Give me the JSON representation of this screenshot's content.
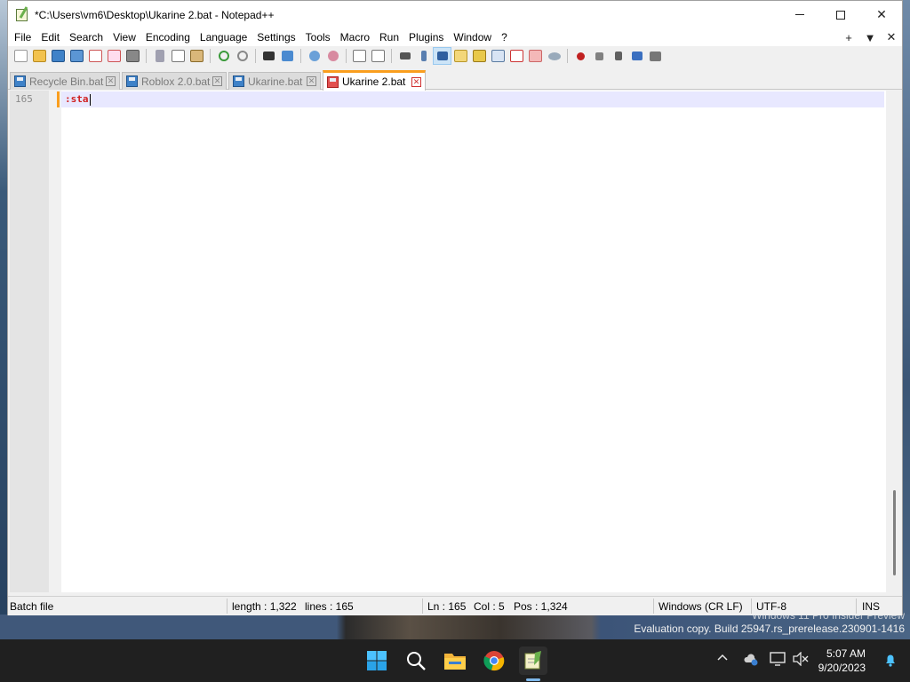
{
  "window": {
    "title": "*C:\\Users\\vm6\\Desktop\\Ukarine 2.bat - Notepad++",
    "controls": {
      "minimize": "minimize",
      "maximize": "maximize",
      "close": "✕"
    }
  },
  "menu": {
    "items": [
      "File",
      "Edit",
      "Search",
      "View",
      "Encoding",
      "Language",
      "Settings",
      "Tools",
      "Macro",
      "Run",
      "Plugins",
      "Window",
      "?"
    ],
    "right": [
      "+",
      "▼",
      "✕"
    ]
  },
  "tabs": [
    {
      "label": "Recycle Bin.bat",
      "active": false
    },
    {
      "label": "Roblox 2.0.bat",
      "active": false
    },
    {
      "label": "Ukarine.bat",
      "active": false
    },
    {
      "label": "Ukarine 2.bat",
      "active": true
    }
  ],
  "editor": {
    "line_number": "165",
    "line_text": ":sta"
  },
  "status": {
    "language": "Batch file",
    "length": "length : 1,322",
    "lines": "lines : 165",
    "ln": "Ln : 165",
    "col": "Col : 5",
    "pos": "Pos : 1,324",
    "eol": "Windows (CR LF)",
    "encoding": "UTF-8",
    "mode": "INS"
  },
  "watermark": {
    "line1": "Windows 11 Pro Insider Preview",
    "line2": "Evaluation copy. Build 25947.rs_prerelease.230901-1416"
  },
  "taskbar": {
    "time": "5:07 AM",
    "date": "9/20/2023",
    "apps": [
      "start-icon",
      "search-icon",
      "file-explorer-icon",
      "chrome-icon",
      "notepad-plus-plus-icon"
    ],
    "tray": [
      "chevron-up-icon",
      "onedrive-icon",
      "network-icon",
      "volume-muted-icon",
      "notification-bell-icon"
    ]
  },
  "colors": {
    "accent": "#fa9e1e",
    "code_text": "#d02020",
    "current_line": "#e8e8ff"
  }
}
